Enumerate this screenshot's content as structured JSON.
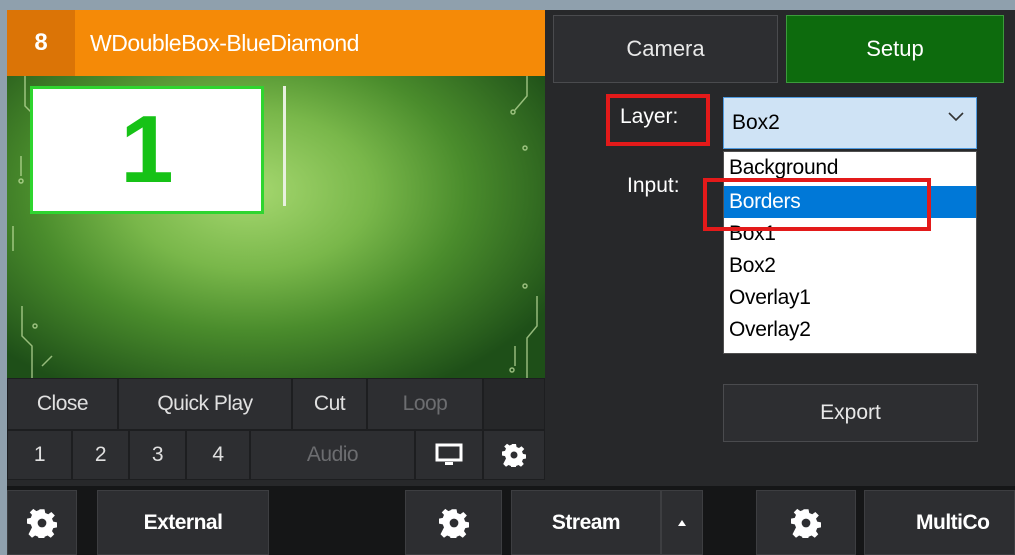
{
  "input": {
    "number": "8",
    "title": "WDoubleBox-BlueDiamond",
    "preview_box_number": "1"
  },
  "controls": {
    "row1": [
      "Close",
      "Quick Play",
      "Cut",
      "Loop"
    ],
    "row2": [
      "1",
      "2",
      "3",
      "4",
      "Audio"
    ],
    "monitor_icon": "monitor-icon",
    "settings_icon": "gear-icon"
  },
  "panel": {
    "camera_label": "Camera",
    "setup_label": "Setup",
    "layer_label": "Layer:",
    "input_label": "Input:",
    "layer_value": "Box2",
    "layer_options": [
      "Background",
      "Borders",
      "Box1",
      "Box2",
      "Overlay1",
      "Overlay2"
    ],
    "highlighted_option": "Borders",
    "export_label": "Export"
  },
  "bottom_bar": {
    "external_label": "External",
    "stream_label": "Stream",
    "multicorder_label": "MultiCo"
  },
  "colors": {
    "title_orange": "#f58a07",
    "setup_green": "#0d6b0d",
    "highlight_red": "#e31a1a",
    "selection_blue": "#0078d7"
  }
}
